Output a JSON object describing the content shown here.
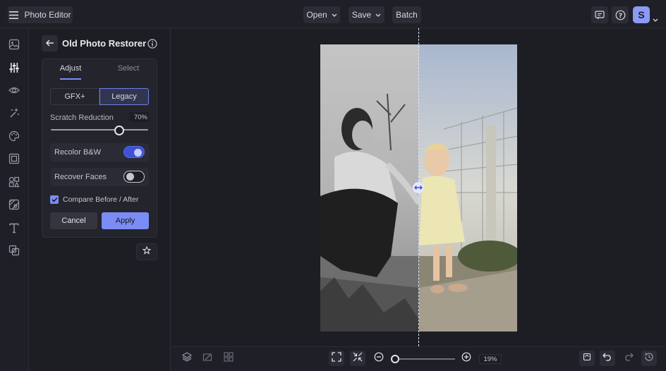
{
  "app": {
    "title": "Photo Editor",
    "user_initial": "S"
  },
  "header": {
    "open_label": "Open",
    "save_label": "Save",
    "batch_label": "Batch"
  },
  "panel": {
    "title": "Old Photo Restorer",
    "tabs": [
      "Adjust",
      "Select"
    ],
    "active_tab": "Adjust",
    "mode_options": [
      "GFX+",
      "Legacy"
    ],
    "selected_mode": "Legacy",
    "scratch_label": "Scratch Reduction",
    "scratch_value": "70",
    "scratch_unit": "%",
    "scratch_fraction": 0.7,
    "recolor_label": "Recolor B&W",
    "recolor_on": true,
    "faces_label": "Recover Faces",
    "faces_on": false,
    "compare_label": "Compare Before / After",
    "compare_checked": true,
    "cancel_label": "Cancel",
    "apply_label": "Apply"
  },
  "zoom": {
    "value": "19",
    "unit": "%"
  },
  "colors": {
    "accent": "#7b8cf5",
    "toggle_on": "#3f51d6",
    "background": "#1d1e24"
  }
}
